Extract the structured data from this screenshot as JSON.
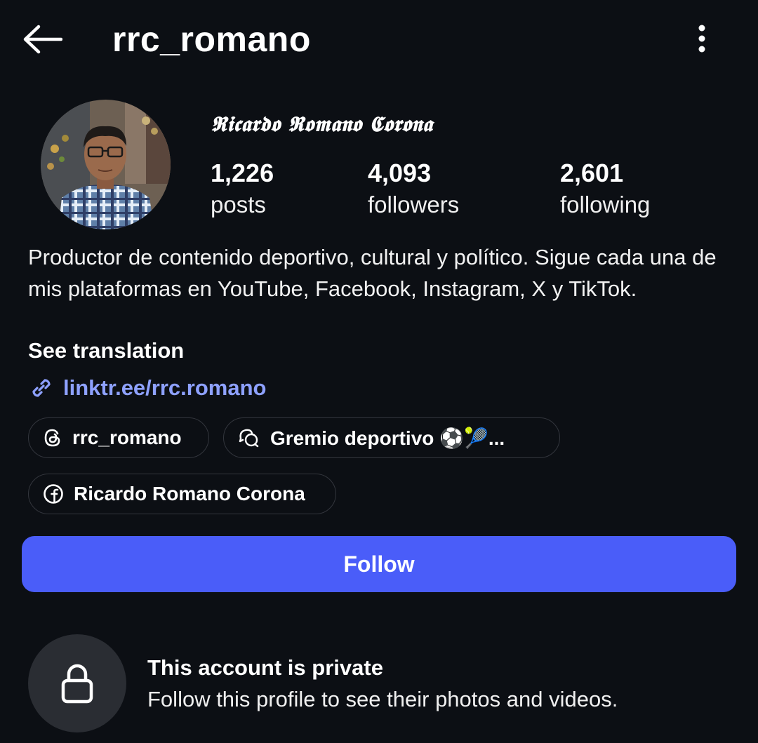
{
  "header": {
    "username": "rrc_romano"
  },
  "profile": {
    "display_name": "𝕽𝖎𝖈𝖆𝖗𝖉𝖔 𝕽𝖔𝖒𝖆𝖓𝖔 𝕮𝖔𝖗𝖔𝖓𝖆",
    "stats": {
      "posts": {
        "value": "1,226",
        "label": "posts"
      },
      "followers": {
        "value": "4,093",
        "label": "followers"
      },
      "following": {
        "value": "2,601",
        "label": "following"
      }
    },
    "bio": "Productor de contenido deportivo, cultural y político. Sigue cada una de mis plataformas en YouTube, Facebook, Instagram, X y TikTok.",
    "see_translation": "See translation",
    "link": "linktr.ee/rrc.romano",
    "chips": {
      "threads": {
        "label": "rrc_romano",
        "icon": "threads-icon"
      },
      "gremio": {
        "label": "Gremio deportivo ⚽🎾...",
        "icon": "chat-bubbles-icon"
      },
      "facebook": {
        "label": "Ricardo Romano Corona",
        "icon": "facebook-icon"
      }
    }
  },
  "actions": {
    "follow_label": "Follow"
  },
  "private_notice": {
    "title": "This account is private",
    "subtitle": "Follow this profile to see their photos and videos."
  },
  "colors": {
    "background": "#0c0f14",
    "accent": "#4a5df9",
    "link": "#8ea1ff",
    "chip_border": "#33363d",
    "lock_circle": "#2a2d33"
  }
}
